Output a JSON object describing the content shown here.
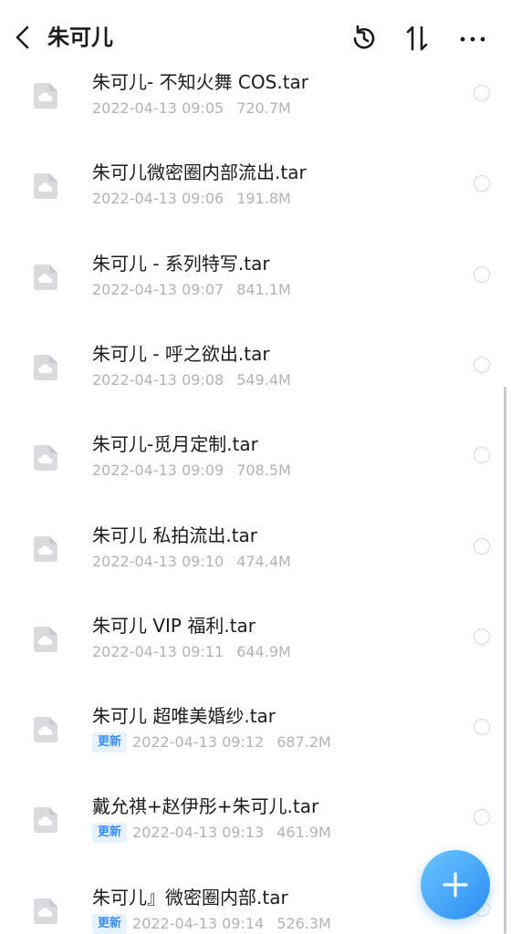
{
  "header": {
    "title": "朱可儿"
  },
  "files": [
    {
      "name": "朱可儿- 不知火舞 COS.tar",
      "date": "2022-04-13 09:05",
      "size": "720.7M",
      "badge": ""
    },
    {
      "name": "朱可儿微密圈内部流出.tar",
      "date": "2022-04-13 09:06",
      "size": "191.8M",
      "badge": ""
    },
    {
      "name": "朱可儿 - 系列特写.tar",
      "date": "2022-04-13 09:07",
      "size": "841.1M",
      "badge": ""
    },
    {
      "name": "朱可儿 - 呼之欲出.tar",
      "date": "2022-04-13 09:08",
      "size": "549.4M",
      "badge": ""
    },
    {
      "name": "朱可儿-觅月定制.tar",
      "date": "2022-04-13 09:09",
      "size": "708.5M",
      "badge": ""
    },
    {
      "name": "朱可儿 私拍流出.tar",
      "date": "2022-04-13 09:10",
      "size": "474.4M",
      "badge": ""
    },
    {
      "name": "朱可儿 VIP 福利.tar",
      "date": "2022-04-13 09:11",
      "size": "644.9M",
      "badge": ""
    },
    {
      "name": "朱可儿 超唯美婚纱.tar",
      "date": "2022-04-13 09:12",
      "size": "687.2M",
      "badge": "更新"
    },
    {
      "name": "戴允祺+赵伊彤+朱可儿.tar",
      "date": "2022-04-13 09:13",
      "size": "461.9M",
      "badge": "更新"
    },
    {
      "name": "朱可儿』微密圈内部.tar",
      "date": "2022-04-13 09:14",
      "size": "526.3M",
      "badge": "更新"
    }
  ],
  "icons": {
    "back": "chevron-left-icon",
    "history": "history-icon",
    "sort": "sort-icon",
    "more": "more-icon",
    "file": "cloud-file-icon",
    "fab": "plus-icon"
  },
  "colors": {
    "accent": "#3a8ef6",
    "badge_bg": "#e7f2fe",
    "meta_text": "#b0b3b8"
  }
}
